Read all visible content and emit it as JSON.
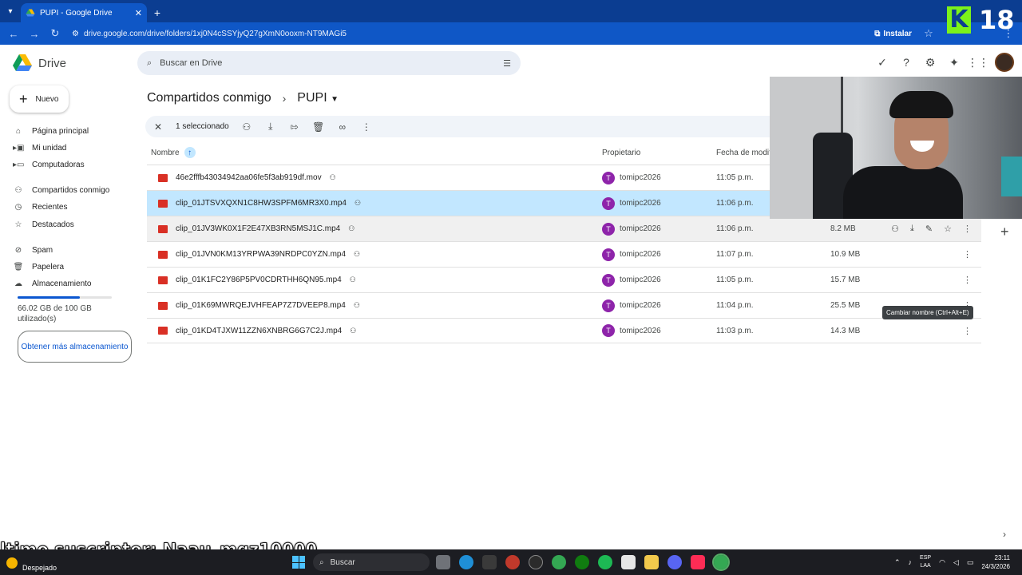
{
  "browser": {
    "tab_title": "PUPI - Google Drive",
    "url": "drive.google.com/drive/folders/1xj0N4cSSYjyQ27gXmN0ooxm-NT9MAGi5",
    "install_label": "Instalar"
  },
  "overlay": {
    "brand_letter": "K",
    "age_rating": "18",
    "caption": "ltimo suscriptor: Naau_mqz10000"
  },
  "drive": {
    "product_name": "Drive",
    "search_placeholder": "Buscar en Drive",
    "new_button": "Nuevo",
    "sidebar": [
      {
        "label": "Página principal",
        "icon": "home-icon"
      },
      {
        "label": "Mi unidad",
        "icon": "drive-icon"
      },
      {
        "label": "Computadoras",
        "icon": "computer-icon"
      },
      {
        "label": "Compartidos conmigo",
        "icon": "people-icon"
      },
      {
        "label": "Recientes",
        "icon": "clock-icon"
      },
      {
        "label": "Destacados",
        "icon": "star-icon"
      },
      {
        "label": "Spam",
        "icon": "spam-icon"
      },
      {
        "label": "Papelera",
        "icon": "trash-icon"
      },
      {
        "label": "Almacenamiento",
        "icon": "cloud-icon"
      }
    ],
    "storage": {
      "used_text": "66.02 GB de 100 GB utilizado(s)",
      "used_fraction": 0.66,
      "more_button": "Obtener más almacenamiento"
    },
    "breadcrumb": {
      "parent": "Compartidos conmigo",
      "current": "PUPI"
    },
    "selection": {
      "count_label": "1 seleccionado"
    },
    "columns": {
      "name": "Nombre",
      "owner": "Propietario",
      "date": "Fecha de modif"
    },
    "files": [
      {
        "name": "46e2fffb43034942aa06fe5f3ab919df.mov",
        "owner": "tomipc2026",
        "owner_initial": "T",
        "date": "11:05 p.m.",
        "size": ""
      },
      {
        "name": "clip_01JTSVXQXN1C8HW3SPFM6MR3X0.mp4",
        "owner": "tomipc2026",
        "owner_initial": "T",
        "date": "11:06 p.m.",
        "size": ""
      },
      {
        "name": "clip_01JV3WK0X1F2E47XB3RN5MSJ1C.mp4",
        "owner": "tomipc2026",
        "owner_initial": "T",
        "date": "11:06 p.m.",
        "size": "8.2 MB"
      },
      {
        "name": "clip_01JVN0KM13YRPWA39NRDPC0YZN.mp4",
        "owner": "tomipc2026",
        "owner_initial": "T",
        "date": "11:07 p.m.",
        "size": "10.9 MB"
      },
      {
        "name": "clip_01K1FC2Y86P5PV0CDRTHH6QN95.mp4",
        "owner": "tomipc2026",
        "owner_initial": "T",
        "date": "11:05 p.m.",
        "size": "15.7 MB"
      },
      {
        "name": "clip_01K69MWRQEJVHFEAP7Z7DVEEP8.mp4",
        "owner": "tomipc2026",
        "owner_initial": "T",
        "date": "11:04 p.m.",
        "size": "25.5 MB"
      },
      {
        "name": "clip_01KD4TJXW11ZZN6XNBRG6G7C2J.mp4",
        "owner": "tomipc2026",
        "owner_initial": "T",
        "date": "11:03 p.m.",
        "size": "14.3 MB"
      }
    ],
    "tooltip": "Cambiar nombre (Ctrl+Alt+E)"
  },
  "taskbar": {
    "weather_label": "Despejado",
    "search_label": "Buscar",
    "lang_top": "ESP",
    "lang_bottom": "LAA",
    "time": "23:11",
    "date": "24/3/2026"
  }
}
